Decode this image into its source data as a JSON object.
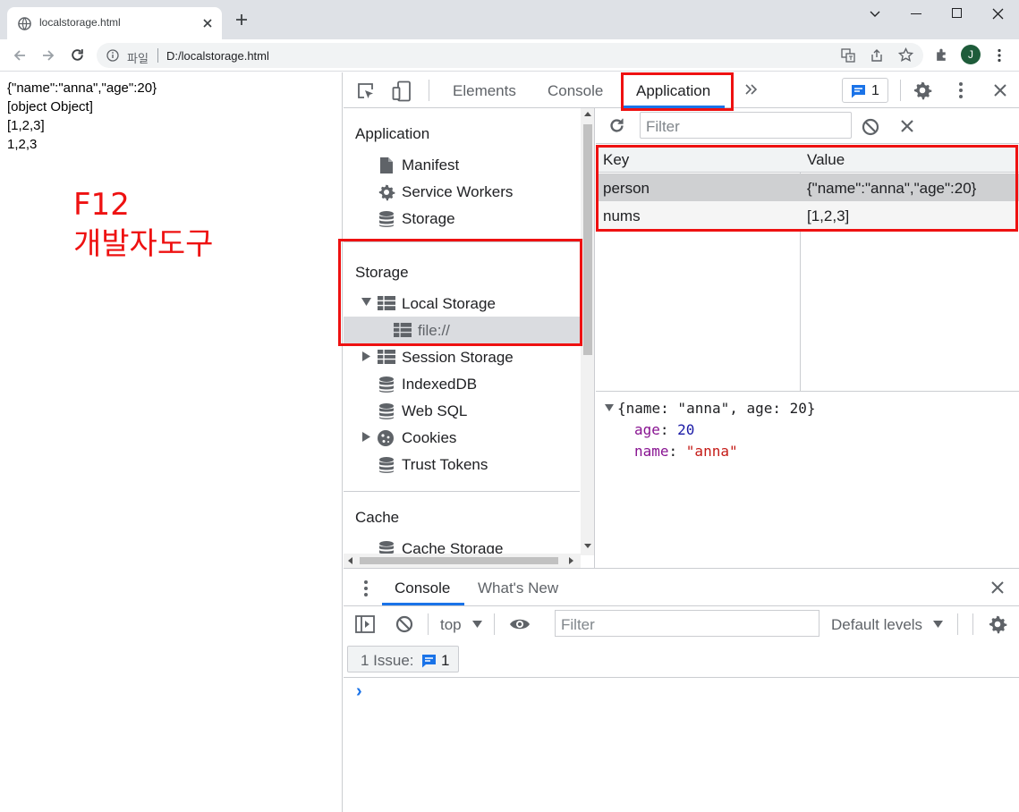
{
  "browser": {
    "tab_title": "localstorage.html",
    "new_tab": "+",
    "scheme_label": "파일",
    "url": "D:/localstorage.html",
    "profile_initial": "J"
  },
  "page": {
    "lines": [
      "{\"name\":\"anna\",\"age\":20}",
      "[object Object]",
      "[1,2,3]",
      "1,2,3"
    ],
    "annotation": [
      "F12",
      "개발자도구"
    ]
  },
  "devtools": {
    "tabs": [
      "Elements",
      "Console",
      "Application"
    ],
    "active_tab": "Application",
    "more_tabs": "»",
    "issues_count": "1",
    "sidebar": {
      "sections": [
        {
          "title": "Application",
          "items": [
            "Manifest",
            "Service Workers",
            "Storage"
          ]
        },
        {
          "title": "Storage",
          "items": [
            "Local Storage",
            "file://",
            "Session Storage",
            "IndexedDB",
            "Web SQL",
            "Cookies",
            "Trust Tokens"
          ]
        },
        {
          "title": "Cache",
          "items": [
            "Cache Storage"
          ]
        }
      ],
      "selected_item": "file://"
    },
    "storage": {
      "filter_placeholder": "Filter",
      "columns": [
        "Key",
        "Value"
      ],
      "rows": [
        {
          "key": "person",
          "value": "{\"name\":\"anna\",\"age\":20}"
        },
        {
          "key": "nums",
          "value": "[1,2,3]"
        }
      ],
      "selected_row": "person",
      "preview": {
        "summary": "{name: \"anna\", age: 20}",
        "props": [
          {
            "name": "age",
            "value": "20"
          },
          {
            "name": "name",
            "value": "\"anna\""
          }
        ]
      }
    },
    "drawer": {
      "tabs": [
        "Console",
        "What's New"
      ],
      "active_tab": "Console",
      "context": "top",
      "filter_placeholder": "Filter",
      "levels": "Default levels",
      "issues_label": "1 Issue:",
      "issues_count": "1",
      "prompt": "›"
    },
    "colors": {
      "accent": "#1a73e8",
      "highlight": "#ee1111",
      "prop_name": "#881391",
      "string": "#c41a16",
      "number": "#1a1aa6"
    }
  }
}
